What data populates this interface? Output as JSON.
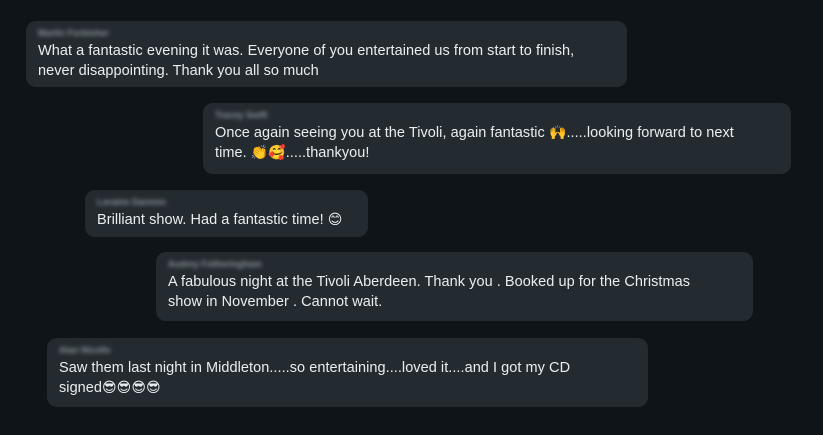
{
  "comments": [
    {
      "author": "Martin Forbisher",
      "text_line1": "What a fantastic evening it was. Everyone of you entertained us from start to finish,",
      "text_line2": "never disappointing. Thank you all so much"
    },
    {
      "author": "Tracey Swift",
      "text_line1_a": "Once again seeing you at the Tivoli, again fantastic ",
      "emoji_1": "🙌",
      "text_line1_b": ".....looking forward to next",
      "text_line2_a": "time. ",
      "emoji_2": "👏🥰",
      "text_line2_b": ".....thankyou!"
    },
    {
      "author": "Loraine Darmon",
      "text": "Brilliant show. Had a fantastic time! ",
      "emoji": "😊"
    },
    {
      "author": "Audrey Fotheringham",
      "text_line1": "A fabulous night at the Tivoli Aberdeen. Thank you . Booked up for the Christmas",
      "text_line2": "show in November . Cannot wait."
    },
    {
      "author": "Alan Nicolls",
      "text_line1": "Saw them last night in Middleton.....so entertaining....loved it....and I got my CD",
      "text_line2": "signed",
      "emoji": "😎😎😎😎"
    }
  ],
  "colors": {
    "background": "#0e1418",
    "bubble": "#242b30",
    "text": "#e9edf0",
    "author": "#8c959c"
  }
}
